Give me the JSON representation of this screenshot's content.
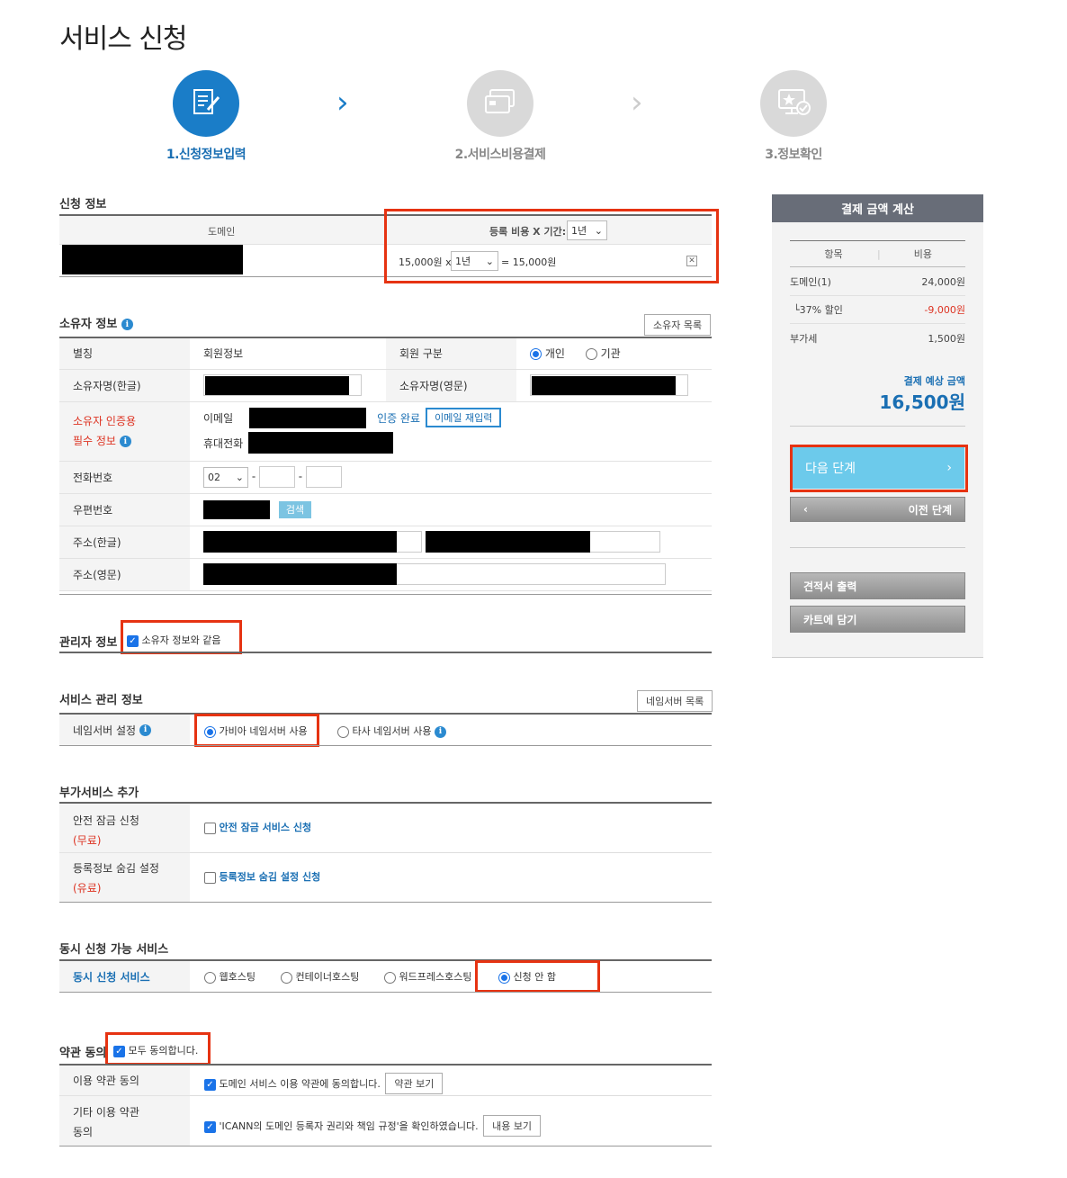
{
  "page_title": "서비스 신청",
  "steps": [
    {
      "label": "1.신청정보입력",
      "active": true,
      "icon": "form-edit-icon"
    },
    {
      "label": "2.서비스비용결제",
      "active": false,
      "icon": "credit-card-icon"
    },
    {
      "label": "3.정보확인",
      "active": false,
      "icon": "monitor-check-icon"
    }
  ],
  "application": {
    "title": "신청 정보",
    "col_domain": "도메인",
    "col_fee": "등록 비용 X 기간:",
    "period_header": "1년",
    "price": "15,000원 x",
    "period_row": "1년",
    "total": "= 15,000원"
  },
  "owner": {
    "title": "소유자 정보",
    "list_btn": "소유자 목록",
    "alias": "별칭",
    "alias_value": "회원정보",
    "member_type": "회원 구분",
    "type_personal": "개인",
    "type_org": "기관",
    "name_kr": "소유자명(한글)",
    "name_en": "소유자명(영문)",
    "auth_line1": "소유자 인증용",
    "auth_line2": "필수 정보",
    "email": "이메일",
    "verified": "인증 완료",
    "reenter": "이메일 재입력",
    "mobile": "휴대전화",
    "phone": "전화번호",
    "phone_area": "02",
    "postal": "우편번호",
    "search": "검색",
    "addr_kr": "주소(한글)",
    "addr_en": "주소(영문)"
  },
  "admin": {
    "title": "관리자 정보",
    "same": "소유자 정보와 같음"
  },
  "service": {
    "title": "서비스 관리 정보",
    "ns_list": "네임서버 목록",
    "ns_label": "네임서버 설정",
    "ns_gabia": "가비아 네임서버 사용",
    "ns_other": "타사 네임서버 사용"
  },
  "addon": {
    "title": "부가서비스 추가",
    "lock_label": "안전 잠금 신청",
    "lock_free": "(무료)",
    "lock_opt": "안전 잠금 서비스 신청",
    "privacy_label": "등록정보 숨김 설정",
    "privacy_paid": "(유료)",
    "privacy_opt": "등록정보 숨김 설정 신청"
  },
  "concurrent": {
    "title": "동시 신청 가능 서비스",
    "label": "동시 신청 서비스",
    "opts": [
      "웹호스팅",
      "컨테이너호스팅",
      "워드프레스호스팅",
      "신청 안 함"
    ]
  },
  "terms": {
    "title": "약관 동의",
    "all": "모두 동의합니다.",
    "usage_label": "이용 약관 동의",
    "usage_text": "도메인 서비스 이용 약관에 동의합니다.",
    "usage_btn": "약관 보기",
    "etc_label1": "기타 이용 약관",
    "etc_label2": "동의",
    "etc_text": "'ICANN의 도메인 등록자 권리와 책임 규정'을 확인하였습니다.",
    "etc_btn": "내용 보기"
  },
  "sidebar": {
    "title": "결제 금액 계산",
    "col_item": "항목",
    "col_cost": "비용",
    "rows": [
      {
        "label": "도메인(1)",
        "value": "24,000원"
      },
      {
        "label": "└37% 할인",
        "value": "-9,000원"
      },
      {
        "label": "부가세",
        "value": "1,500원"
      }
    ],
    "expected_label": "결제 예상 금액",
    "expected_value": "16,500원",
    "next": "다음 단계",
    "prev": "이전 단계",
    "quote": "견적서 출력",
    "cart": "카트에 담기"
  },
  "colors": {
    "accent": "#1a7dc8",
    "highlight": "#e63312",
    "next_button": "#6ccaeb",
    "discount": "#dd3322"
  }
}
